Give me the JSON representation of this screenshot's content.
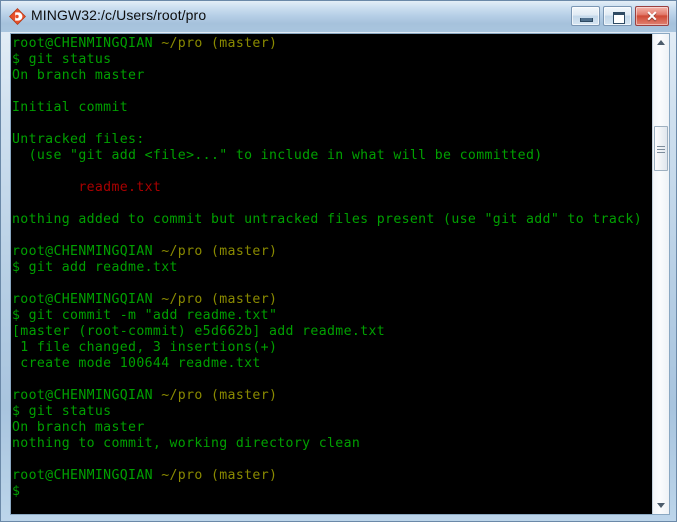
{
  "window": {
    "title": "MINGW32:/c/Users/root/pro",
    "icon": "git-diamond-icon",
    "buttons": {
      "minimize_label": "",
      "maximize_label": "",
      "close_label": "✕"
    }
  },
  "terminal": {
    "colors": {
      "background": "#000000",
      "green": "#00a000",
      "olive": "#8a8a00",
      "red": "#a80000"
    },
    "prompt": {
      "user_host": "root@CHENMINGQIAN",
      "path": "~/pro",
      "branch": "(master)"
    },
    "lines": [
      {
        "type": "prompt"
      },
      {
        "type": "text",
        "color": "green",
        "text": "$ git status"
      },
      {
        "type": "text",
        "color": "green",
        "text": "On branch master"
      },
      {
        "type": "blank"
      },
      {
        "type": "text",
        "color": "green",
        "text": "Initial commit"
      },
      {
        "type": "blank"
      },
      {
        "type": "text",
        "color": "green",
        "text": "Untracked files:"
      },
      {
        "type": "text",
        "color": "green",
        "text": "  (use \"git add <file>...\" to include in what will be committed)"
      },
      {
        "type": "blank"
      },
      {
        "type": "text",
        "color": "red",
        "text": "        readme.txt"
      },
      {
        "type": "blank"
      },
      {
        "type": "text",
        "color": "green",
        "text": "nothing added to commit but untracked files present (use \"git add\" to track)"
      },
      {
        "type": "blank"
      },
      {
        "type": "prompt"
      },
      {
        "type": "text",
        "color": "green",
        "text": "$ git add readme.txt"
      },
      {
        "type": "blank"
      },
      {
        "type": "prompt"
      },
      {
        "type": "text",
        "color": "green",
        "text": "$ git commit -m \"add readme.txt\""
      },
      {
        "type": "text",
        "color": "green",
        "text": "[master (root-commit) e5d662b] add readme.txt"
      },
      {
        "type": "text",
        "color": "green",
        "text": " 1 file changed, 3 insertions(+)"
      },
      {
        "type": "text",
        "color": "green",
        "text": " create mode 100644 readme.txt"
      },
      {
        "type": "blank"
      },
      {
        "type": "prompt"
      },
      {
        "type": "text",
        "color": "green",
        "text": "$ git status"
      },
      {
        "type": "text",
        "color": "green",
        "text": "On branch master"
      },
      {
        "type": "text",
        "color": "green",
        "text": "nothing to commit, working directory clean"
      },
      {
        "type": "blank"
      },
      {
        "type": "prompt"
      },
      {
        "type": "text",
        "color": "green",
        "text": "$"
      }
    ]
  },
  "scrollbar": {
    "up_arrow": "scroll-up-arrow",
    "down_arrow": "scroll-down-arrow",
    "thumb_top_pct": 19,
    "thumb_height_pct": 9
  }
}
